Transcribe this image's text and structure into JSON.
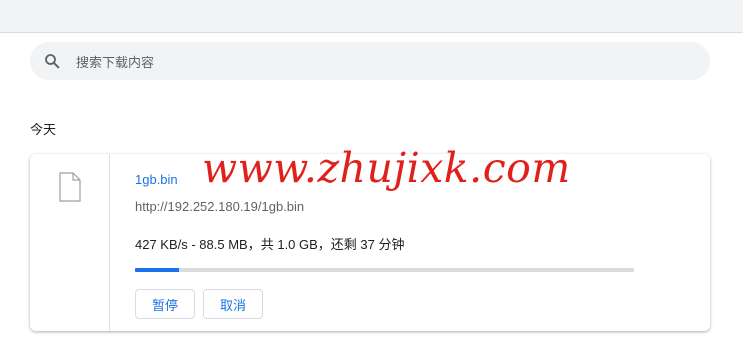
{
  "search": {
    "placeholder": "搜索下载内容",
    "icon": "search-icon"
  },
  "section": {
    "date_label": "今天"
  },
  "download": {
    "file_icon": "file-icon",
    "filename": "1gb.bin",
    "url": "http://192.252.180.19/1gb.bin",
    "status": "427 KB/s - 88.5 MB，共 1.0 GB，还剩 37 分钟",
    "progress_fraction": 0.0885,
    "pause_label": "暂停",
    "cancel_label": "取消"
  },
  "watermark": {
    "text": "www.zhujixk.com",
    "color": "#e0211b"
  },
  "colors": {
    "accent": "#1a73e8",
    "track": "#dadce0",
    "search_bg": "#f1f3f4"
  }
}
